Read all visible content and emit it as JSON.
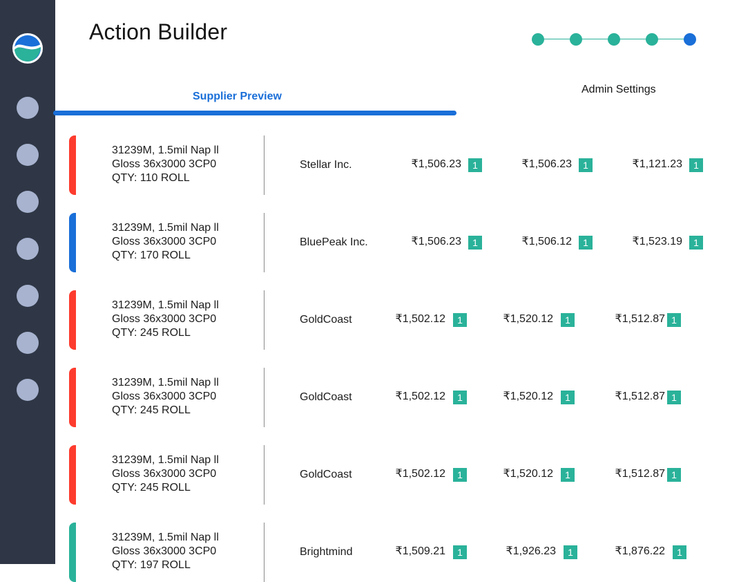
{
  "header": {
    "title": "Action Builder"
  },
  "stepper": {
    "steps": 5,
    "active_step": 5
  },
  "tabs": [
    {
      "label": "Supplier Preview",
      "active": true
    },
    {
      "label": "Admin Settings",
      "active": false
    }
  ],
  "rows": [
    {
      "accent": "#fd3c2e",
      "product": [
        "31239M, 1.5mil Nap ll",
        "Gloss 36x3000 3CP0",
        "QTY: 110 ROLL"
      ],
      "supplier": "Stellar Inc.",
      "prices": [
        {
          "value": "₹1,506.23",
          "badge": "1"
        },
        {
          "value": "₹1,506.23",
          "badge": "1"
        },
        {
          "value": "₹1,121.23",
          "badge": "1"
        }
      ]
    },
    {
      "accent": "#1a6fd8",
      "product": [
        "31239M, 1.5mil Nap ll",
        "Gloss 36x3000 3CP0",
        "QTY: 170 ROLL"
      ],
      "supplier": "BluePeak Inc.",
      "prices": [
        {
          "value": "₹1,506.23",
          "badge": "1"
        },
        {
          "value": "₹1,506.12",
          "badge": "1"
        },
        {
          "value": "₹1,523.19",
          "badge": "1"
        }
      ]
    },
    {
      "accent": "#fd3c2e",
      "product": [
        "31239M, 1.5mil Nap ll",
        "Gloss 36x3000 3CP0",
        "QTY: 245 ROLL"
      ],
      "supplier": "GoldCoast",
      "prices": [
        {
          "value": "₹1,502.12",
          "badge": "1"
        },
        {
          "value": "₹1,520.12",
          "badge": "1"
        },
        {
          "value": "₹1,512.87",
          "badge": "1"
        }
      ]
    },
    {
      "accent": "#fd3c2e",
      "product": [
        "31239M, 1.5mil Nap ll",
        "Gloss 36x3000 3CP0",
        "QTY: 245 ROLL"
      ],
      "supplier": "GoldCoast",
      "prices": [
        {
          "value": "₹1,502.12",
          "badge": "1"
        },
        {
          "value": "₹1,520.12",
          "badge": "1"
        },
        {
          "value": "₹1,512.87",
          "badge": "1"
        }
      ]
    },
    {
      "accent": "#fd3c2e",
      "product": [
        "31239M, 1.5mil Nap ll",
        "Gloss 36x3000 3CP0",
        "QTY: 245 ROLL"
      ],
      "supplier": "GoldCoast",
      "prices": [
        {
          "value": "₹1,502.12",
          "badge": "1"
        },
        {
          "value": "₹1,520.12",
          "badge": "1"
        },
        {
          "value": "₹1,512.87",
          "badge": "1"
        }
      ]
    },
    {
      "accent": "#2ab29a",
      "product": [
        "31239M, 1.5mil Nap ll",
        "Gloss 36x3000 3CP0",
        "QTY: 197 ROLL"
      ],
      "supplier": "Brightmind",
      "prices": [
        {
          "value": "₹1,509.21",
          "badge": "1"
        },
        {
          "value": "₹1,926.23",
          "badge": "1"
        },
        {
          "value": "₹1,876.22",
          "badge": "1"
        }
      ]
    }
  ],
  "colors": {
    "sidebar": "#2f3746",
    "nav_dot": "#a7b3cf",
    "accent_blue": "#1a6fd8",
    "teal": "#2ab29a",
    "red": "#fd3c2e"
  }
}
